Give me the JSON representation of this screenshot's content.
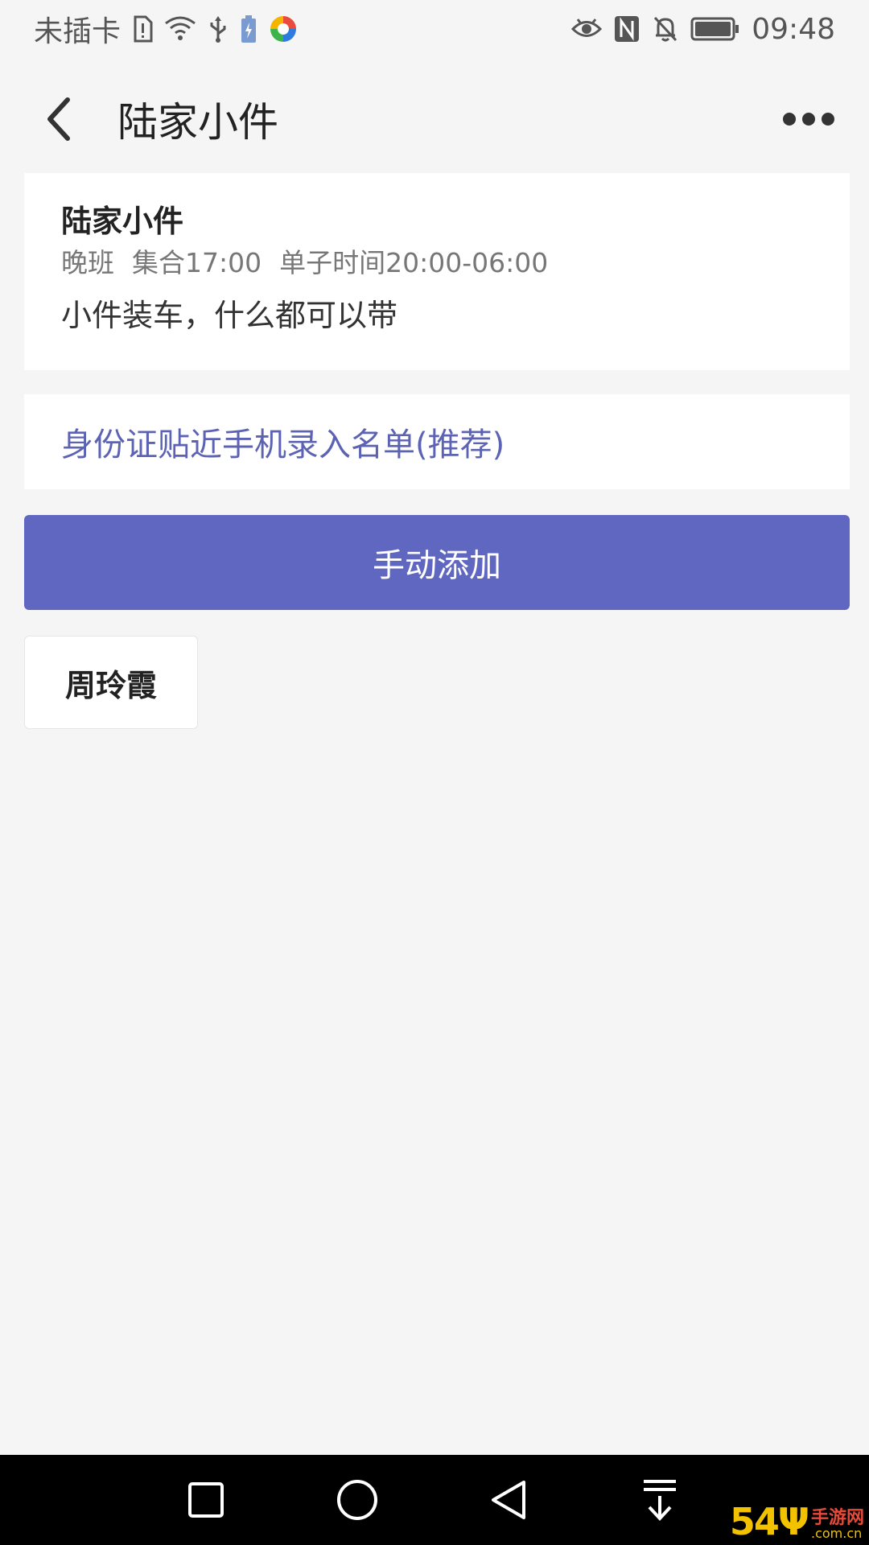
{
  "status_bar": {
    "carrier": "未插卡",
    "time": "09:48"
  },
  "header": {
    "title": "陆家小件"
  },
  "info_card": {
    "title": "陆家小件",
    "shift": "晚班",
    "gather": "集合17:00",
    "work_time": "单子时间20:00-06:00",
    "description": "小件装车，什么都可以带"
  },
  "id_entry": {
    "label": "身份证贴近手机录入名单(推荐)"
  },
  "manual_add": {
    "label": "手动添加"
  },
  "people": [
    {
      "name": "周玲霞"
    }
  ],
  "watermark": {
    "logo": "54Ψ",
    "text": "手游网",
    "domain": ".com.cn"
  },
  "colors": {
    "accent": "#6067c0",
    "link": "#5d63b3",
    "background": "#f5f5f5"
  },
  "icons": {
    "back": "chevron-left-icon",
    "more": "more-dots-icon",
    "nav_recent": "square-icon",
    "nav_home": "circle-icon",
    "nav_back": "triangle-back-icon",
    "nav_notifications": "pull-down-icon"
  }
}
